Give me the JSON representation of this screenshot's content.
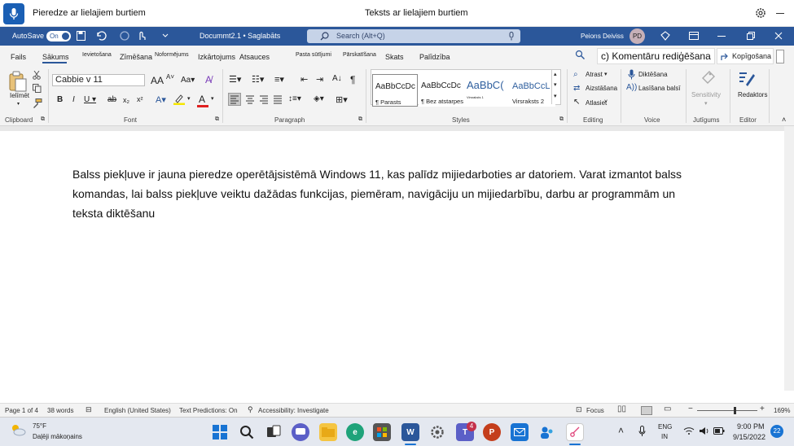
{
  "voice_access": {
    "status_text": "Pieredze ar lielajiem burtiem",
    "center_text": "Teksts ar lielajiem burtiem"
  },
  "titlebar": {
    "autosave_label": "AutoSave",
    "autosave_state": "On",
    "doc_title": "Docummt2.1 • Saglabāts",
    "search_placeholder": "Search (Alt+Q)",
    "user_name": "Peiorıs Deiviss",
    "user_initials": "PD"
  },
  "tabs": {
    "items": [
      "Fails",
      "Sākums",
      "Ievietošana",
      "Zīmēšana",
      "Noformējums",
      "Izkārtojums",
      "Atsauces",
      "Pasta sūtījumi",
      "Pārskatīšana",
      "Skats",
      "Palīdzība"
    ],
    "active": "Sākums",
    "comment_mode": "c) Komentāru rediģēšana",
    "share_label": "Kopīgošana"
  },
  "ribbon": {
    "clipboard": {
      "paste_label": "Ielīmēt",
      "group_label": "Clipboard"
    },
    "font": {
      "font_name": "Cabbie v 11",
      "group_label": "Font"
    },
    "paragraph": {
      "group_label": "Paragraph"
    },
    "styles": {
      "group_label": "Styles",
      "items": [
        {
          "preview": "AaBbCcDc",
          "name": "¶ Parasts"
        },
        {
          "preview": "AaBbCcDc",
          "name": "¶ Bez atstarpes"
        },
        {
          "preview": "AaBbC(",
          "name": "Virsraksts 1"
        },
        {
          "preview": "AaBbCcL",
          "name": "Virsraksts 2"
        }
      ]
    },
    "editing": {
      "find": "Atrast",
      "replace": "Aizstāšana",
      "select": "Atlasiet",
      "group_label": "Editing"
    },
    "voice": {
      "dictate": "Diktēšana",
      "read_aloud": "Lasīšana balsī",
      "group_label": "Voice"
    },
    "sensitivity": {
      "label": "Sensitivity",
      "group_label": "Jutīgums"
    },
    "editor": {
      "label": "Redaktors",
      "group_label": "Editor"
    }
  },
  "document": {
    "paragraph": "Balss piekļuve ir jauna pieredze operētājsistēmā Windows 11, kas palīdz mijiedarboties ar datoriem. Varat izmantot balss komandas, lai balss piekļuve veiktu dažādas funkcijas, piemēram, navigāciju un mijiedarbību, darbu ar programmām un teksta diktēšanu"
  },
  "statusbar": {
    "page": "Page 1 of 4",
    "words": "38 words",
    "language": "English (United States)",
    "text_predictions": "Text Predictions: On",
    "accessibility": "Accessibility: Investigate",
    "focus": "Focus",
    "zoom": "169%",
    "zoom_level": 0.62
  },
  "taskbar": {
    "weather_temp": "75°F",
    "weather_desc": "Daļēji mākoņains",
    "teams_badge": "4",
    "lang_top": "ENG",
    "lang_bottom": "IN",
    "time": "9:00 PM",
    "date": "9/15/2022",
    "notifications": "22"
  },
  "colors": {
    "title_bar": "#2b579a",
    "voice_mic": "#1a5fb4",
    "ribbon_bg": "#f3f3f3",
    "taskbar_bg": "#e4e8f0"
  }
}
